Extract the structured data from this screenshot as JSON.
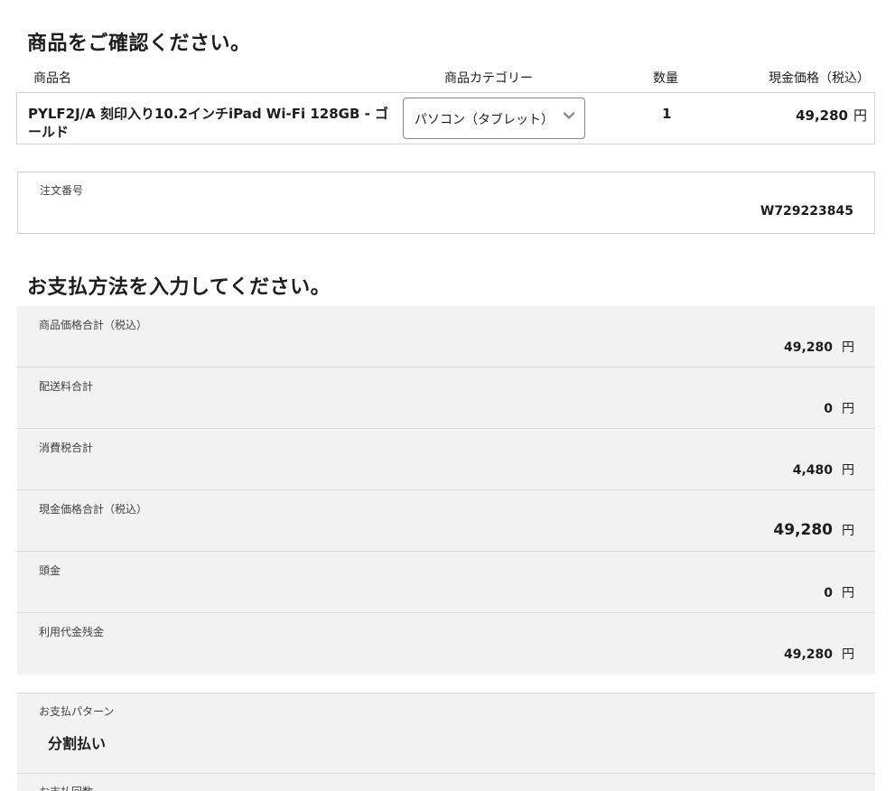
{
  "confirm_section": {
    "title": "商品をご確認ください。",
    "columns": {
      "name": "商品名",
      "category": "商品カテゴリー",
      "quantity": "数量",
      "price": "現金価格（税込）"
    },
    "product": {
      "name": "PYLF2J/A 刻印入り10.2インチiPad Wi-Fi 128GB - ゴールド",
      "category_selected": "パソコン（タブレット）",
      "quantity": "1",
      "price": "49,280",
      "currency": "円"
    }
  },
  "order": {
    "label": "注文番号",
    "value": "W729223845"
  },
  "payment_section": {
    "title": "お支払方法を入力してください。",
    "summary": [
      {
        "label": "商品価格合計（税込）",
        "value": "49,280",
        "currency": "円"
      },
      {
        "label": "配送料合計",
        "value": "0",
        "currency": "円"
      },
      {
        "label": "消費税合計",
        "value": "4,480",
        "currency": "円"
      },
      {
        "label": "現金価格合計（税込）",
        "value": "49,280",
        "currency": "円"
      },
      {
        "label": "頭金",
        "value": "0",
        "currency": "円"
      },
      {
        "label": "利用代金残金",
        "value": "49,280",
        "currency": "円"
      }
    ],
    "pattern": {
      "label": "お支払パターン",
      "value": "分割払い"
    },
    "count": {
      "label": "お支払回数"
    }
  },
  "icons": {
    "select_chevron": "chevron-down-icon"
  },
  "colors": {
    "summary_bg": "#f2f2f2",
    "border": "#d2d2d7",
    "text": "#1d1d1f"
  }
}
